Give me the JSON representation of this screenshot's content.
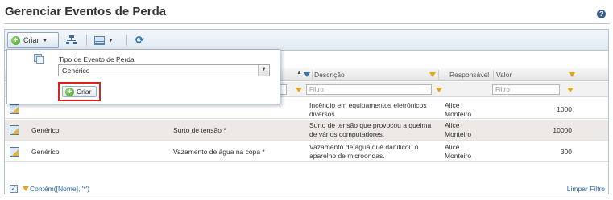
{
  "page": {
    "title": "Gerenciar Eventos de Perda",
    "help_icon": "help-icon"
  },
  "toolbar": {
    "criar_label": "Criar"
  },
  "popup": {
    "label": "Tipo de Evento de Perda",
    "select_value": "Genérico",
    "button_label": "Criar"
  },
  "grid": {
    "columns": {
      "descricao": "Descrição",
      "responsavel": "Responsável",
      "valor": "Valor"
    },
    "filter_placeholder": "Filtro",
    "rows": [
      {
        "tipo": "",
        "nome": "",
        "descricao": "Incêndio em equipamentos eletrônicos diversos.",
        "responsavel": "Alice Monteiro",
        "valor": "1000"
      },
      {
        "tipo": "Genérico",
        "nome": "Surto de tensão *",
        "descricao": "Surto de tensão que provocou a queima de vários computadores.",
        "responsavel": "Alice Monteiro",
        "valor": "10000"
      },
      {
        "tipo": "Genérico",
        "nome": "Vazamento de água na copa *",
        "descricao": "Vazamento de água que danificou o aparelho de microondas.",
        "responsavel": "Alice Monteiro",
        "valor": "300"
      }
    ]
  },
  "footer": {
    "filter_expression": "Contém([Nome], '*')",
    "clear_filter": "Limpar Filtro"
  },
  "colors": {
    "accent": "#1f5fae",
    "alt_row": "#ece9e6",
    "highlight": "#e0201a"
  }
}
